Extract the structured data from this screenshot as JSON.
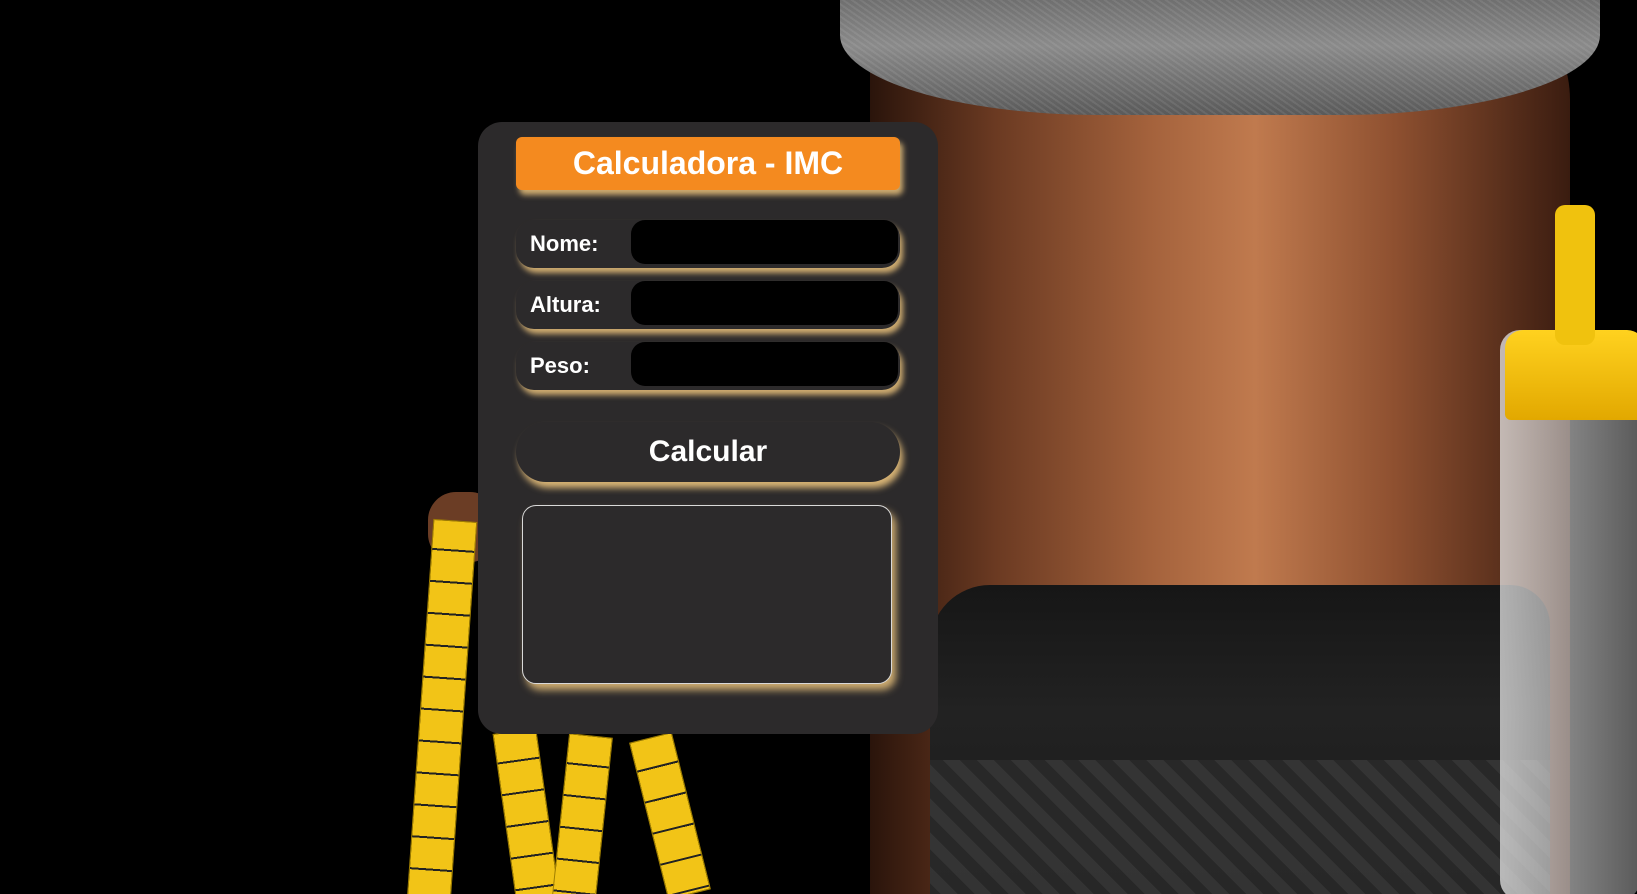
{
  "app": {
    "title": "Calculadora - IMC"
  },
  "form": {
    "fields": [
      {
        "label": "Nome:",
        "value": "",
        "placeholder": ""
      },
      {
        "label": "Altura:",
        "value": "",
        "placeholder": ""
      },
      {
        "label": "Peso:",
        "value": "",
        "placeholder": ""
      }
    ],
    "submit_label": "Calcular"
  },
  "result": {
    "text": ""
  },
  "colors": {
    "accent": "#f48a1f",
    "card": "#2c2a2b",
    "glow": "#ebc37d",
    "input": "#000000"
  }
}
